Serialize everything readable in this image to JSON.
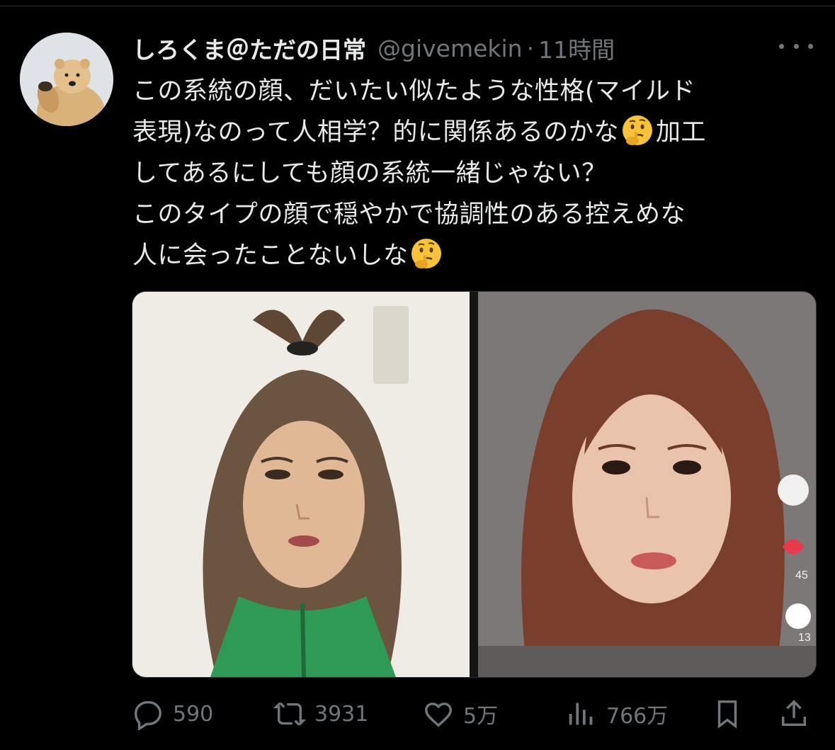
{
  "tweet": {
    "display_name": "しろくま＠ただの日常",
    "handle": "@givemekin",
    "separator": "·",
    "time": "11時間",
    "avatar_icon": "polar-bear-avatar",
    "more_icon": "more-icon",
    "text_lines": [
      "この系統の顔、だいたい似たような性格(マイルド",
      "表現)なのって人相学？的に関係あるのかな",
      "加工",
      "してあるにしても顔の系統一緒じゃない？",
      "このタイプの顔で穏やかで協調性のある控えめな",
      "人に会ったことないしな"
    ],
    "emoji": "thinking-face",
    "media": {
      "left_image": "portrait-woman-green-jacket",
      "right_image": "portrait-woman-brown-hair",
      "right_side_counts": [
        "45",
        "13"
      ]
    },
    "actions": {
      "replies": "590",
      "retweets": "3931",
      "likes": "5万",
      "views": "766万",
      "icons": [
        "reply-icon",
        "retweet-icon",
        "like-icon",
        "views-icon",
        "bookmark-icon",
        "share-icon"
      ]
    }
  },
  "colors": {
    "background": "#000000",
    "text": "#e7e9ea",
    "secondary_text": "#71767b",
    "border": "#2f3336"
  }
}
